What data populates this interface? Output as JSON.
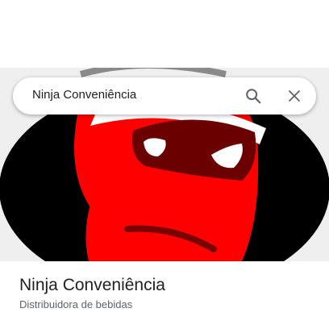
{
  "search": {
    "query": "Ninja Conveniência",
    "search_icon": "search-icon",
    "close_icon": "close-icon"
  },
  "hero": {
    "image": "ninja-logo-photo",
    "colors": {
      "red": "#ff0000",
      "mask": "#6b0000",
      "black": "#000000",
      "headband": "#ffffff",
      "background": "#efefef"
    }
  },
  "place": {
    "name": "Ninja Conveniência",
    "category": "Distribuidora de bebidas"
  }
}
